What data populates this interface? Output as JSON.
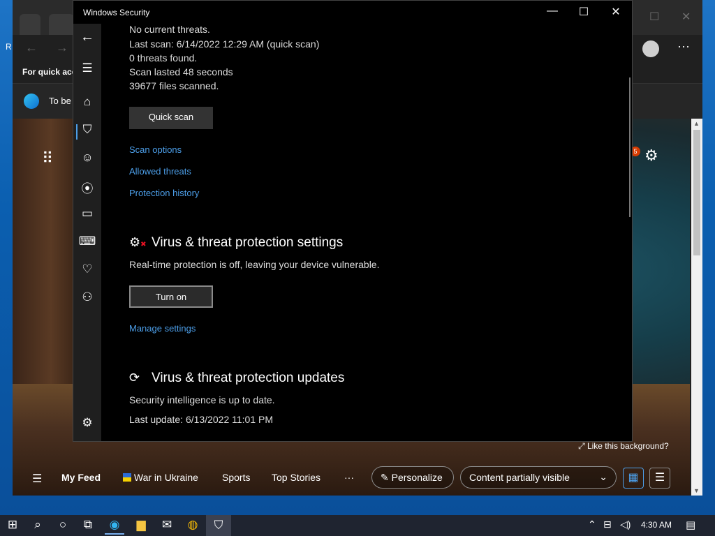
{
  "desktop": {
    "label_top": "R"
  },
  "edge": {
    "fav_text": "For quick acc",
    "row2_text": "To be",
    "like_bg": "Like this background?",
    "badge_count": "5",
    "feed": {
      "menu": "☰",
      "my_feed": "My Feed",
      "war": "War in Ukraine",
      "sports": "Sports",
      "top_stories": "Top Stories",
      "more": "···",
      "personalize": "Personalize",
      "content": "Content partially visible"
    }
  },
  "window": {
    "title": "Windows Security",
    "controls": {
      "minimize": "—",
      "maximize": "☐",
      "close": "✕"
    }
  },
  "scan": {
    "line1": "No current threats.",
    "line2": "Last scan: 6/14/2022 12:29 AM (quick scan)",
    "line3": "0 threats found.",
    "line4": "Scan lasted 48 seconds",
    "line5": "39677 files scanned.",
    "quick_scan": "Quick scan",
    "links": [
      "Scan options",
      "Allowed threats",
      "Protection history"
    ]
  },
  "settings": {
    "heading": "Virus & threat protection settings",
    "desc": "Real-time protection is off, leaving your device vulnerable.",
    "turn_on": "Turn on",
    "manage": "Manage settings"
  },
  "updates": {
    "heading": "Virus & threat protection updates",
    "desc": "Security intelligence is up to date.",
    "last_update": "Last update: 6/13/2022 11:01 PM"
  },
  "taskbar": {
    "time": "4:30 AM"
  }
}
